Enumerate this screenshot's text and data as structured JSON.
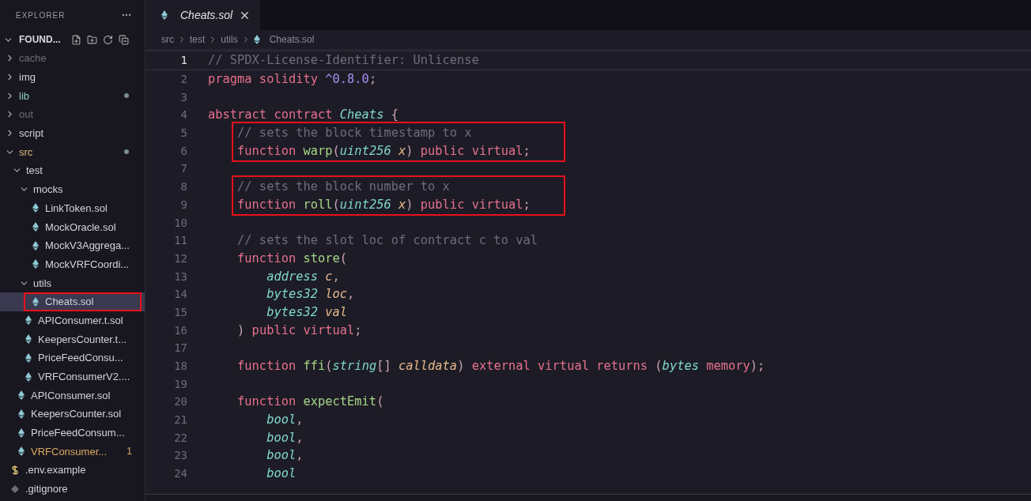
{
  "sidebar": {
    "title": "EXPLORER",
    "project": "FOUND...",
    "tree": [
      {
        "label": "cache",
        "kind": "folder",
        "expanded": false,
        "color": "#6e6d7a",
        "dot": false,
        "selected": false,
        "highlighted": false
      },
      {
        "label": "img",
        "kind": "folder",
        "expanded": false,
        "color": "#d2d2da",
        "dot": false,
        "selected": false,
        "highlighted": false
      },
      {
        "label": "lib",
        "kind": "folder",
        "expanded": false,
        "color": "#8fd0c0",
        "dot": true,
        "selected": false,
        "highlighted": false
      },
      {
        "label": "out",
        "kind": "folder",
        "expanded": false,
        "color": "#6e6d7a",
        "dot": false,
        "selected": false,
        "highlighted": false
      },
      {
        "label": "script",
        "kind": "folder",
        "expanded": false,
        "color": "#d2d2da",
        "dot": false,
        "selected": false,
        "highlighted": false
      },
      {
        "label": "src",
        "kind": "folder",
        "expanded": true,
        "color": "#d9b77a",
        "dot": true,
        "selected": false,
        "highlighted": false,
        "children": [
          {
            "label": "test",
            "kind": "folder",
            "expanded": true,
            "color": "#d2d2da",
            "dot": false,
            "selected": false,
            "highlighted": false,
            "children": [
              {
                "label": "mocks",
                "kind": "folder",
                "expanded": true,
                "color": "#d2d2da",
                "dot": false,
                "selected": false,
                "highlighted": false,
                "children": [
                  {
                    "label": "LinkToken.sol",
                    "kind": "sol",
                    "color": "#d2d2da",
                    "dot": false,
                    "selected": false,
                    "highlighted": false
                  },
                  {
                    "label": "MockOracle.sol",
                    "kind": "sol",
                    "color": "#d2d2da",
                    "dot": false,
                    "selected": false,
                    "highlighted": false
                  },
                  {
                    "label": "MockV3Aggrega...",
                    "kind": "sol",
                    "color": "#d2d2da",
                    "dot": false,
                    "selected": false,
                    "highlighted": false
                  },
                  {
                    "label": "MockVRFCoordi...",
                    "kind": "sol",
                    "color": "#d2d2da",
                    "dot": false,
                    "selected": false,
                    "highlighted": false
                  }
                ]
              },
              {
                "label": "utils",
                "kind": "folder",
                "expanded": true,
                "color": "#d2d2da",
                "dot": false,
                "selected": false,
                "highlighted": false,
                "children": [
                  {
                    "label": "Cheats.sol",
                    "kind": "sol",
                    "color": "#d2d2da",
                    "dot": false,
                    "selected": true,
                    "highlighted": true
                  }
                ]
              },
              {
                "label": "APIConsumer.t.sol",
                "kind": "sol",
                "color": "#d2d2da",
                "dot": false,
                "selected": false,
                "highlighted": false
              },
              {
                "label": "KeepersCounter.t...",
                "kind": "sol",
                "color": "#d2d2da",
                "dot": false,
                "selected": false,
                "highlighted": false
              },
              {
                "label": "PriceFeedConsu...",
                "kind": "sol",
                "color": "#d2d2da",
                "dot": false,
                "selected": false,
                "highlighted": false
              },
              {
                "label": "VRFConsumerV2....",
                "kind": "sol",
                "color": "#d2d2da",
                "dot": false,
                "selected": false,
                "highlighted": false
              }
            ]
          },
          {
            "label": "APIConsumer.sol",
            "kind": "sol",
            "color": "#d2d2da",
            "dot": false,
            "selected": false,
            "highlighted": false
          },
          {
            "label": "KeepersCounter.sol",
            "kind": "sol",
            "color": "#d2d2da",
            "dot": false,
            "selected": false,
            "highlighted": false
          },
          {
            "label": "PriceFeedConsum...",
            "kind": "sol",
            "color": "#d2d2da",
            "dot": false,
            "selected": false,
            "highlighted": false
          },
          {
            "label": "VRFConsumer...",
            "kind": "sol",
            "color": "#d9a860",
            "badge": "1",
            "dot": false,
            "selected": false,
            "highlighted": false
          }
        ]
      },
      {
        "label": ".env.example",
        "kind": "env",
        "color": "#d2d2da",
        "dot": false,
        "selected": false,
        "highlighted": false
      },
      {
        "label": ".gitignore",
        "kind": "git",
        "color": "#d2d2da",
        "dot": false,
        "selected": false,
        "highlighted": false
      }
    ]
  },
  "tabs": [
    {
      "label": "Cheats.sol",
      "selected": true,
      "preview": true
    }
  ],
  "breadcrumb": [
    "src",
    "test",
    "utils",
    "Cheats.sol"
  ],
  "code": {
    "blocks": [
      {
        "highlighted": false,
        "lines": [
          {
            "n": "1",
            "current": true,
            "tokens": [
              {
                "kind": "comment",
                "t": "// SPDX-License-Identifier: Unlicense"
              }
            ]
          },
          {
            "n": "2",
            "current": false,
            "tokens": [
              {
                "kind": "kw",
                "t": "pragma solidity "
              },
              {
                "kind": "num",
                "t": "^0.8.0"
              },
              {
                "kind": "punct",
                "t": ";"
              }
            ]
          },
          {
            "n": "3",
            "current": false
          },
          {
            "n": "4",
            "current": false,
            "tokens": [
              {
                "kind": "kw",
                "t": "abstract contract "
              },
              {
                "kind": "type",
                "t": "Cheats"
              },
              {
                "kind": "punct",
                "t": " {"
              }
            ]
          }
        ]
      },
      {
        "highlighted": true,
        "lines": [
          {
            "n": "5",
            "current": false,
            "tokens": [
              {
                "kind": "comment",
                "t": "    // sets the block timestamp to x"
              }
            ]
          },
          {
            "n": "6",
            "current": false,
            "tokens": [
              {
                "kind": "kw",
                "t": "    function "
              },
              {
                "kind": "fn",
                "t": "warp"
              },
              {
                "kind": "punct",
                "t": "("
              },
              {
                "kind": "type",
                "t": "uint256"
              },
              {
                "kind": "param",
                "t": " x"
              },
              {
                "kind": "punct",
                "t": ") "
              },
              {
                "kind": "kw",
                "t": "public virtual"
              },
              {
                "kind": "punct",
                "t": ";"
              }
            ]
          }
        ]
      },
      {
        "highlighted": false,
        "lines": [
          {
            "n": "7",
            "current": false
          }
        ]
      },
      {
        "highlighted": true,
        "lines": [
          {
            "n": "8",
            "current": false,
            "tokens": [
              {
                "kind": "comment",
                "t": "    // sets the block number to x"
              }
            ]
          },
          {
            "n": "9",
            "current": false,
            "tokens": [
              {
                "kind": "kw",
                "t": "    function "
              },
              {
                "kind": "fn",
                "t": "roll"
              },
              {
                "kind": "punct",
                "t": "("
              },
              {
                "kind": "type",
                "t": "uint256"
              },
              {
                "kind": "param",
                "t": " x"
              },
              {
                "kind": "punct",
                "t": ") "
              },
              {
                "kind": "kw",
                "t": "public virtual"
              },
              {
                "kind": "punct",
                "t": ";"
              }
            ]
          }
        ]
      },
      {
        "highlighted": false,
        "lines": [
          {
            "n": "10",
            "current": false
          },
          {
            "n": "11",
            "current": false,
            "tokens": [
              {
                "kind": "comment",
                "t": "    // sets the slot loc of contract c to val"
              }
            ]
          },
          {
            "n": "12",
            "current": false,
            "tokens": [
              {
                "kind": "kw",
                "t": "    function "
              },
              {
                "kind": "fn",
                "t": "store"
              },
              {
                "kind": "punct",
                "t": "("
              }
            ]
          },
          {
            "n": "13",
            "current": false,
            "tokens": [
              {
                "kind": "type",
                "t": "        address"
              },
              {
                "kind": "param",
                "t": " c"
              },
              {
                "kind": "punct",
                "t": ","
              }
            ]
          },
          {
            "n": "14",
            "current": false,
            "tokens": [
              {
                "kind": "type",
                "t": "        bytes32"
              },
              {
                "kind": "param",
                "t": " loc"
              },
              {
                "kind": "punct",
                "t": ","
              }
            ]
          },
          {
            "n": "15",
            "current": false,
            "tokens": [
              {
                "kind": "type",
                "t": "        bytes32"
              },
              {
                "kind": "param",
                "t": " val"
              }
            ]
          },
          {
            "n": "16",
            "current": false,
            "tokens": [
              {
                "kind": "punct",
                "t": "    ) "
              },
              {
                "kind": "kw",
                "t": "public virtual"
              },
              {
                "kind": "punct",
                "t": ";"
              }
            ]
          },
          {
            "n": "17",
            "current": false
          },
          {
            "n": "18",
            "current": false,
            "tokens": [
              {
                "kind": "kw",
                "t": "    function "
              },
              {
                "kind": "fn",
                "t": "ffi"
              },
              {
                "kind": "punct",
                "t": "("
              },
              {
                "kind": "type",
                "t": "string"
              },
              {
                "kind": "punct",
                "t": "[]"
              },
              {
                "kind": "param",
                "t": " calldata"
              },
              {
                "kind": "punct",
                "t": ") "
              },
              {
                "kind": "kw",
                "t": "external virtual returns "
              },
              {
                "kind": "punct",
                "t": "("
              },
              {
                "kind": "type",
                "t": "bytes"
              },
              {
                "kind": "kw",
                "t": " memory"
              },
              {
                "kind": "punct",
                "t": ");"
              }
            ]
          },
          {
            "n": "19",
            "current": false
          },
          {
            "n": "20",
            "current": false,
            "tokens": [
              {
                "kind": "kw",
                "t": "    function "
              },
              {
                "kind": "fn",
                "t": "expectEmit"
              },
              {
                "kind": "punct",
                "t": "("
              }
            ]
          },
          {
            "n": "21",
            "current": false,
            "tokens": [
              {
                "kind": "type",
                "t": "        bool"
              },
              {
                "kind": "punct",
                "t": ","
              }
            ]
          },
          {
            "n": "22",
            "current": false,
            "tokens": [
              {
                "kind": "type",
                "t": "        bool"
              },
              {
                "kind": "punct",
                "t": ","
              }
            ]
          },
          {
            "n": "23",
            "current": false,
            "tokens": [
              {
                "kind": "type",
                "t": "        bool"
              },
              {
                "kind": "punct",
                "t": ","
              }
            ]
          },
          {
            "n": "24",
            "current": false,
            "tokens": [
              {
                "kind": "type",
                "t": "        bool"
              }
            ]
          }
        ]
      }
    ]
  }
}
